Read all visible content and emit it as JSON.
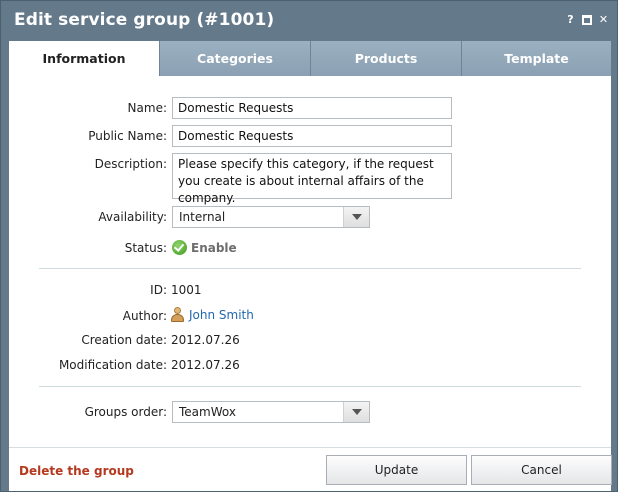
{
  "window": {
    "title": "Edit service group (#1001)",
    "help_glyph": "?",
    "close_glyph": "✕"
  },
  "tabs": [
    {
      "label": "Information",
      "active": true
    },
    {
      "label": "Categories",
      "active": false
    },
    {
      "label": "Products",
      "active": false
    },
    {
      "label": "Template",
      "active": false
    }
  ],
  "form": {
    "name_label": "Name:",
    "name_value": "Domestic Requests",
    "public_name_label": "Public Name:",
    "public_name_value": "Domestic Requests",
    "description_label": "Description:",
    "description_value": "Please specify this category, if the request you create is about internal affairs of the company.",
    "availability_label": "Availability:",
    "availability_value": "Internal",
    "status_label": "Status:",
    "status_value": "Enable"
  },
  "info": {
    "id_label": "ID:",
    "id_value": "1001",
    "author_label": "Author:",
    "author_value": "John Smith",
    "creation_label": "Creation date:",
    "creation_value": "2012.07.26",
    "modification_label": "Modification date:",
    "modification_value": "2012.07.26"
  },
  "order": {
    "label": "Groups order:",
    "value": "TeamWox"
  },
  "footer": {
    "delete_label": "Delete the group",
    "update_label": "Update",
    "cancel_label": "Cancel"
  },
  "icons": {
    "status": "check-circle-icon",
    "author": "user-icon",
    "help": "help-icon",
    "maximize": "maximize-icon",
    "close": "close-icon"
  },
  "colors": {
    "window_chrome": "#64798a",
    "tab_inactive": "#8ba1b3",
    "link": "#2369b0",
    "delete": "#b4391e",
    "status_green": "#3e9a1e"
  }
}
